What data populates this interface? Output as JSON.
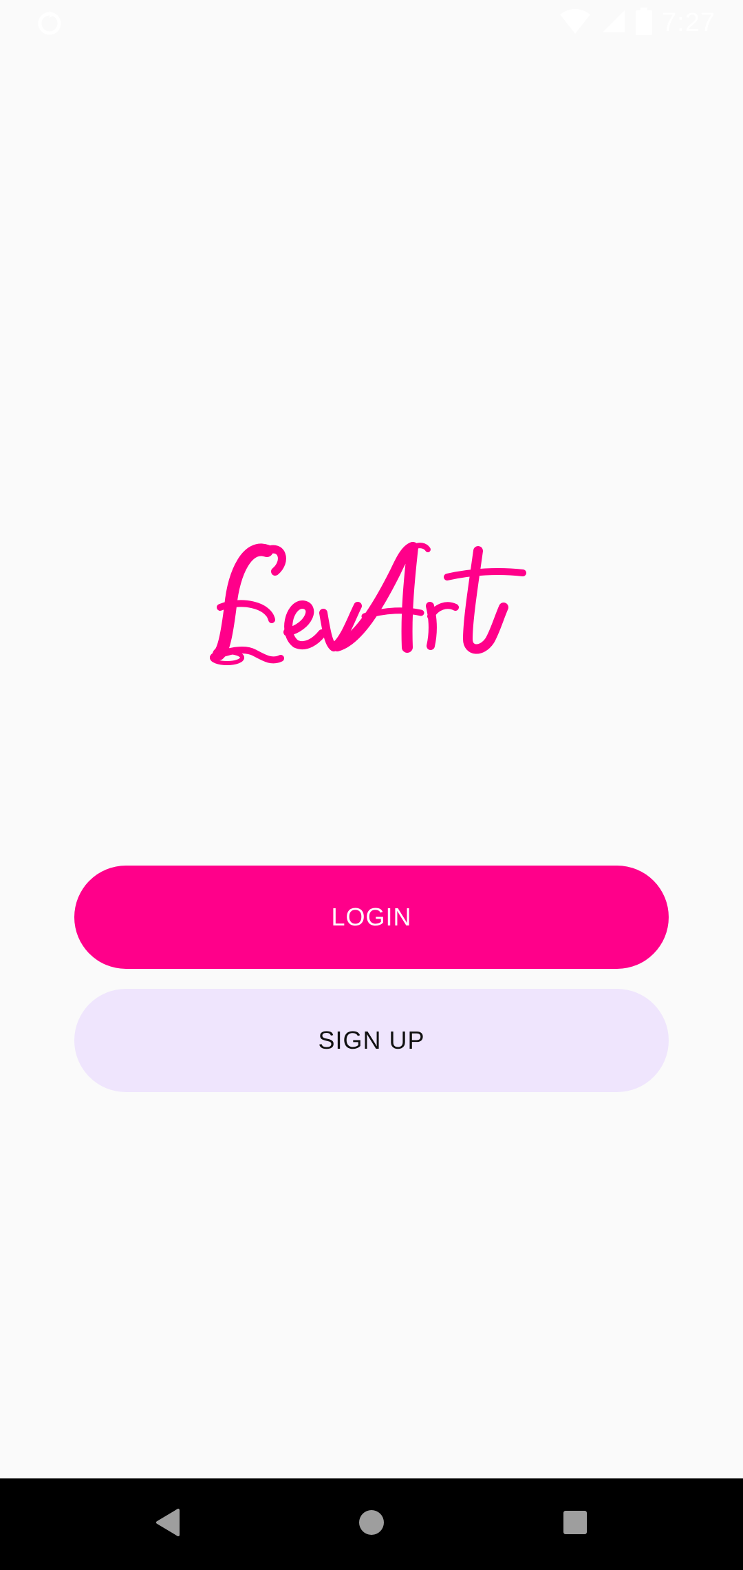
{
  "status_bar": {
    "time": "7:27",
    "icons": [
      "sync-icon",
      "wifi-icon",
      "cellular-signal-icon",
      "battery-icon"
    ],
    "icon_color": "#ffffff"
  },
  "app": {
    "logo_text": "LevArt",
    "brand_color": "#ff008a"
  },
  "buttons": {
    "login_label": "LOGIN",
    "signup_label": "SIGN UP",
    "login_bg": "#ff008a",
    "signup_bg": "#efe5fd"
  },
  "nav_bar": {
    "icons": [
      "back-icon",
      "home-icon",
      "recents-icon"
    ],
    "icon_color": "#9e9e9e"
  }
}
